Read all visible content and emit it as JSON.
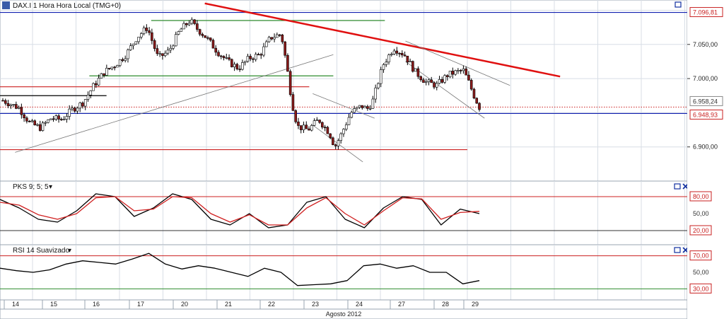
{
  "colors": {
    "up": "#ffffff",
    "down": "#8b1a1a",
    "wick": "#000000",
    "grid": "#d8dee6",
    "trend_red": "#e01010",
    "blue_line": "#1020b0",
    "green_line": "#2e8b2e",
    "red_line": "#cc2020",
    "thin_trend": "#777777",
    "badge_red_border": "#c82020",
    "badge_red_text": "#c82020",
    "badge_gray_border": "#888888",
    "stoch_k": "#000000",
    "stoch_d": "#d02020",
    "rsi": "#000000",
    "panel_btn": "#1030a0"
  },
  "icons": {
    "panel_buttons": [
      "maximize-icon",
      "close-icon"
    ],
    "chart_logo": "chart-icon"
  },
  "chart_data": [
    {
      "type": "candlestick",
      "title": "DAX.I 1 Hora Hora Local (TMG+0)",
      "xlabel": "Agosto 2012",
      "x_ticks": [
        "14",
        "15",
        "16",
        "17",
        "20",
        "21",
        "22",
        "23",
        "24",
        "27",
        "28",
        "29"
      ],
      "ylim": [
        6850,
        7115
      ],
      "y_ticks": [
        6900,
        6950,
        7000,
        7050,
        7100
      ],
      "y_tick_labels": [
        "6.900,00",
        "7.000,00",
        "7.050,00"
      ],
      "grid": true,
      "price_labels": [
        {
          "value": 7096.81,
          "label": "7.096,81",
          "style": "red"
        },
        {
          "value": 6958.24,
          "label": "6.958,24",
          "style": "gray"
        },
        {
          "value": 6948.93,
          "label": "6.948,93",
          "style": "red"
        }
      ],
      "close_path": [
        [
          0,
          6968
        ],
        [
          3,
          6957
        ],
        [
          5,
          6935
        ],
        [
          7,
          6928
        ],
        [
          9,
          6942
        ],
        [
          11,
          6940
        ],
        [
          13,
          6955
        ],
        [
          15,
          6965
        ],
        [
          17,
          6990
        ],
        [
          19,
          7010
        ],
        [
          21,
          7020
        ],
        [
          23,
          7035
        ],
        [
          25,
          7060
        ],
        [
          27,
          7075
        ],
        [
          29,
          7030
        ],
        [
          31,
          7040
        ],
        [
          33,
          7070
        ],
        [
          35,
          7085
        ],
        [
          36,
          7075
        ],
        [
          38,
          7060
        ],
        [
          40,
          7040
        ],
        [
          42,
          7025
        ],
        [
          44,
          7015
        ],
        [
          46,
          7030
        ],
        [
          48,
          7035
        ],
        [
          50,
          7060
        ],
        [
          52,
          7065
        ],
        [
          53,
          7020
        ],
        [
          54,
          6965
        ],
        [
          55,
          6930
        ],
        [
          57,
          6925
        ],
        [
          59,
          6940
        ],
        [
          61,
          6920
        ],
        [
          62,
          6900
        ],
        [
          63,
          6915
        ],
        [
          65,
          6950
        ],
        [
          67,
          6960
        ],
        [
          68,
          6955
        ],
        [
          69,
          6965
        ],
        [
          71,
          7020
        ],
        [
          73,
          7045
        ],
        [
          75,
          7035
        ],
        [
          77,
          7010
        ],
        [
          79,
          6995
        ],
        [
          81,
          6990
        ],
        [
          83,
          7005
        ],
        [
          84,
          7008
        ],
        [
          86,
          7012
        ],
        [
          87,
          6995
        ],
        [
          88,
          6975
        ],
        [
          89,
          6958
        ]
      ],
      "horizontal_lines": [
        {
          "value": 7096.81,
          "from": 0,
          "to": 1.0,
          "color": "blue"
        },
        {
          "value": 6948.93,
          "from": 0,
          "to": 1.0,
          "color": "blue"
        },
        {
          "value": 6958.24,
          "from": 0,
          "to": 1.0,
          "color": "red_dotted"
        },
        {
          "value": 6988,
          "from": 0,
          "to": 0.45,
          "color": "red"
        },
        {
          "value": 6896,
          "from": 0,
          "to": 0.68,
          "color": "red"
        },
        {
          "value": 7085,
          "from": 0.22,
          "to": 0.56,
          "color": "green"
        },
        {
          "value": 7004,
          "from": 0.13,
          "to": 0.485,
          "color": "green"
        },
        {
          "value": 6975,
          "from": 0.0,
          "to": 0.155,
          "color": "black"
        }
      ],
      "trend_lines": [
        {
          "from": [
            0.298,
            7110
          ],
          "to": [
            0.815,
            7003
          ],
          "color": "red",
          "width": 2.5
        },
        {
          "from": [
            0.022,
            6892
          ],
          "to": [
            0.485,
            7035
          ],
          "color": "gray",
          "width": 0.8
        },
        {
          "from": [
            0.455,
            6978
          ],
          "to": [
            0.545,
            6942
          ],
          "color": "gray",
          "width": 0.8
        },
        {
          "from": [
            0.455,
            6932
          ],
          "to": [
            0.528,
            6878
          ],
          "color": "gray",
          "width": 0.8
        },
        {
          "from": [
            0.59,
            7055
          ],
          "to": [
            0.742,
            6990
          ],
          "color": "gray",
          "width": 0.8
        },
        {
          "from": [
            0.59,
            7025
          ],
          "to": [
            0.705,
            6942
          ],
          "color": "gray",
          "width": 0.8
        }
      ]
    },
    {
      "type": "line",
      "title": "PKS 9; 5; 5",
      "ylim": [
        0,
        100
      ],
      "y_ticks": [
        80,
        50,
        20
      ],
      "y_tick_labels": [
        "80,00",
        "50,00",
        "20,00"
      ],
      "levels": [
        80,
        20
      ],
      "series": [
        {
          "values": [
            75,
            60,
            40,
            35,
            55,
            85,
            80,
            45,
            60,
            85,
            75,
            40,
            30,
            50,
            25,
            30,
            70,
            80,
            40,
            25,
            60,
            80,
            75,
            30,
            58,
            50
          ]
        },
        {
          "values": [
            70,
            65,
            48,
            40,
            50,
            78,
            80,
            55,
            58,
            80,
            78,
            50,
            35,
            48,
            30,
            30,
            60,
            78,
            50,
            30,
            55,
            78,
            76,
            40,
            52,
            54
          ]
        }
      ]
    },
    {
      "type": "line",
      "title": "RSI 14 Suavizado",
      "ylim": [
        20,
        80
      ],
      "y_ticks": [
        70,
        50,
        30
      ],
      "y_tick_labels": [
        "70,00",
        "50,00",
        "30,00"
      ],
      "levels": [
        70,
        30
      ],
      "series": [
        {
          "values": [
            55,
            52,
            50,
            53,
            60,
            64,
            62,
            60,
            66,
            73,
            60,
            54,
            58,
            55,
            50,
            45,
            55,
            50,
            34,
            35,
            36,
            40,
            58,
            60,
            55,
            58,
            50,
            50,
            36,
            40
          ]
        }
      ]
    }
  ]
}
